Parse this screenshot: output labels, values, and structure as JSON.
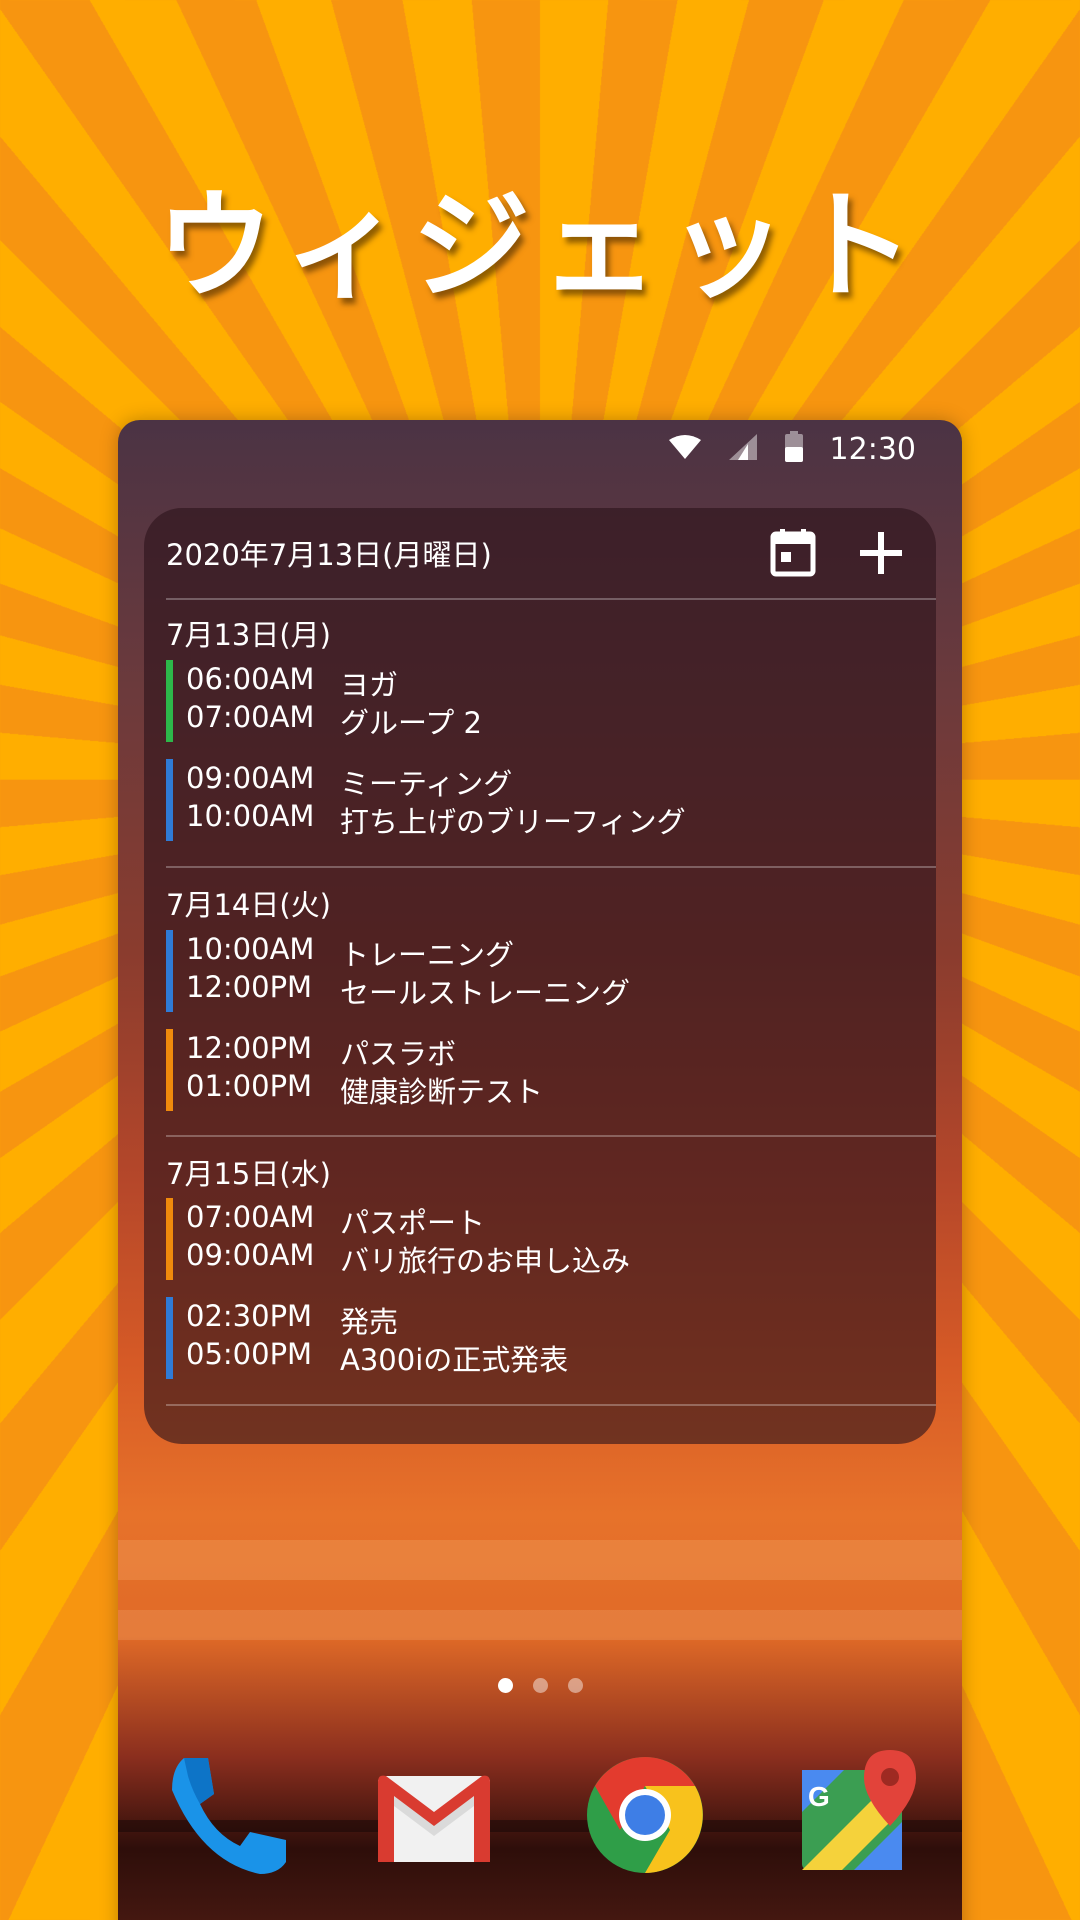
{
  "headline": "ウィジェット",
  "status_bar": {
    "time": "12:30",
    "icons": [
      "wifi-icon",
      "cell-signal-icon",
      "battery-icon"
    ]
  },
  "widget": {
    "header_date": "2020年7月13日(月曜日)",
    "calendar_icon": "calendar-icon",
    "add_icon": "plus-icon",
    "days": [
      {
        "label": "7月13日(月)",
        "events": [
          {
            "start": "06:00AM",
            "end": "07:00AM",
            "title": "ヨガ",
            "subtitle": "グループ 2",
            "color": "#2DB84A"
          },
          {
            "start": "09:00AM",
            "end": "10:00AM",
            "title": "ミーティング",
            "subtitle": "打ち上げのブリーフィング",
            "color": "#2F7BD6"
          }
        ]
      },
      {
        "label": "7月14日(火)",
        "events": [
          {
            "start": "10:00AM",
            "end": "12:00PM",
            "title": "トレーニング",
            "subtitle": "セールストレーニング",
            "color": "#2F7BD6"
          },
          {
            "start": "12:00PM",
            "end": "01:00PM",
            "title": "パスラボ",
            "subtitle": "健康診断テスト",
            "color": "#F08A0C"
          }
        ]
      },
      {
        "label": "7月15日(水)",
        "events": [
          {
            "start": "07:00AM",
            "end": "09:00AM",
            "title": "パスポート",
            "subtitle": "バリ旅行のお申し込み",
            "color": "#F08A0C"
          },
          {
            "start": "02:30PM",
            "end": "05:00PM",
            "title": "発売",
            "subtitle": "A300iの正式発表",
            "color": "#2F7BD6"
          }
        ]
      }
    ]
  },
  "page_indicator": {
    "count": 3,
    "active": 1
  },
  "dock": [
    "phone-icon",
    "gmail-icon",
    "chrome-icon",
    "maps-icon"
  ],
  "colors": {
    "background_a": "#FFAE00",
    "background_b": "#F79510",
    "green": "#2DB84A",
    "blue": "#2F7BD6",
    "orange": "#F08A0C"
  }
}
